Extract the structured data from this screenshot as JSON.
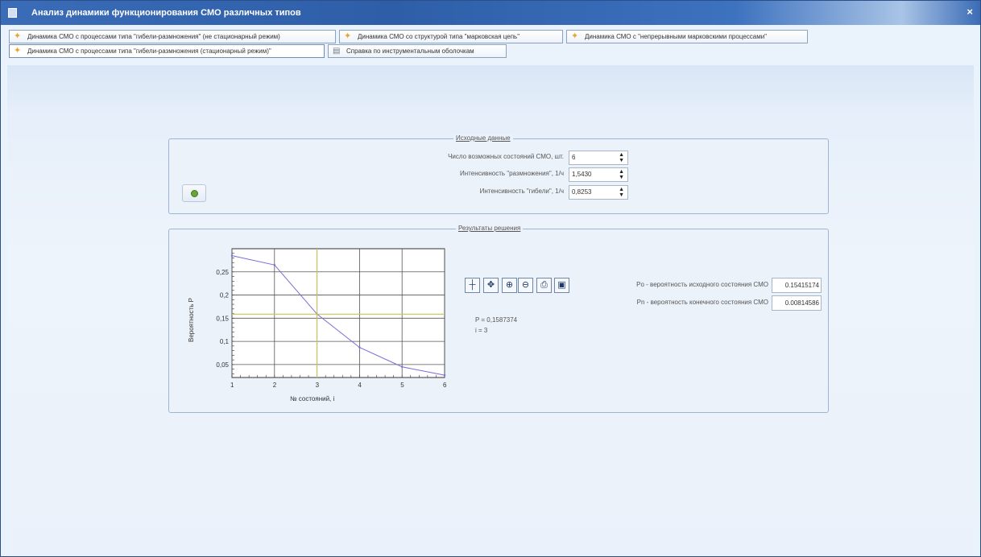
{
  "window": {
    "title": "Анализ динамики функционирования СМО различных типов",
    "close_glyph": "×"
  },
  "tabs": [
    {
      "label": "Динамика СМО с процессами типа \"гибели-размножения\" (не стационарный режим)",
      "icon": "puzzle-icon",
      "active": false
    },
    {
      "label": "Динамика СМО со структурой типа \"марковская цепь\"",
      "icon": "puzzle-icon",
      "active": false
    },
    {
      "label": "Динамика СМО с \"непрерывными марковскими процессами\"",
      "icon": "puzzle-icon",
      "active": false
    },
    {
      "label": "Динамика СМО с процессами типа \"гибели-размножения (стационарный режим)\"",
      "icon": "puzzle-icon",
      "active": true
    },
    {
      "label": "Справка по инструментальным оболочкам",
      "icon": "book-icon",
      "active": false
    }
  ],
  "input": {
    "caption": "Исходные данные",
    "states_label": "Число возможных состояний СМО, шт.",
    "states_value": "6",
    "birth_label": "Интенсивность \"размножения\", 1/ч",
    "birth_value": "1,5430",
    "death_label": "Интенсивность \"гибели\", 1/ч",
    "death_value": "0,8253",
    "spin_glyph": "▲▼"
  },
  "results": {
    "caption": "Результаты решения",
    "cursor_p": "P = 0,1587374",
    "cursor_i": "i = 3",
    "p0_label": "Po - вероятность исходного состояния СМО",
    "p0_value": "0.15415174",
    "pn_label": "Pn - вероятность конечного состояния СМО",
    "pn_value": "0.00814586"
  },
  "toolbar": [
    {
      "name": "crosshair-tool-button",
      "glyph": "┼"
    },
    {
      "name": "pan-tool-button",
      "glyph": "✥"
    },
    {
      "name": "zoom-in-button",
      "glyph": "⊕"
    },
    {
      "name": "zoom-out-button",
      "glyph": "⊖"
    },
    {
      "name": "print-button",
      "glyph": "⎙"
    },
    {
      "name": "save-button",
      "glyph": "▣"
    }
  ],
  "colors": {
    "series": "#7a6bd6",
    "cursor": "#c9c25a",
    "titlebar": "#2e5ea8"
  },
  "chart_data": {
    "type": "line",
    "xlabel": "№ состояний, i",
    "ylabel": "Вероятность P",
    "xlim": [
      1,
      6
    ],
    "ylim": [
      0.022,
      0.3
    ],
    "xticks": [
      "1",
      "2",
      "3",
      "4",
      "5",
      "6"
    ],
    "yticks": [
      {
        "value": 0.05,
        "label": "0,05"
      },
      {
        "value": 0.1,
        "label": "0,1"
      },
      {
        "value": 0.15,
        "label": "0,15"
      },
      {
        "value": 0.2,
        "label": "0,2"
      },
      {
        "value": 0.25,
        "label": "0,25"
      }
    ],
    "grid": true,
    "series": [
      {
        "x": [
          1,
          2,
          3,
          4,
          5,
          6
        ],
        "values": [
          0.285,
          0.265,
          0.159,
          0.087,
          0.045,
          0.027
        ]
      }
    ],
    "cursor": {
      "x": 3,
      "y": 0.1587374
    }
  }
}
